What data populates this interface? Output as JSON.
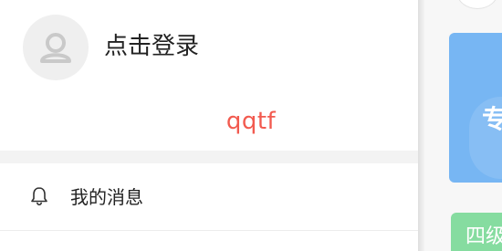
{
  "drawer": {
    "profile": {
      "login_label": "点击登录",
      "avatar_icon": "user-icon"
    },
    "brand_text": "qqtf",
    "menu": [
      {
        "label": "我的消息",
        "icon": "bell-icon"
      }
    ]
  },
  "background": {
    "blue_card_text": "专",
    "green_card_text": "四级"
  },
  "colors": {
    "brand_red": "#f25a4f",
    "card_blue": "#77b6f3",
    "card_green": "#86dca0"
  }
}
